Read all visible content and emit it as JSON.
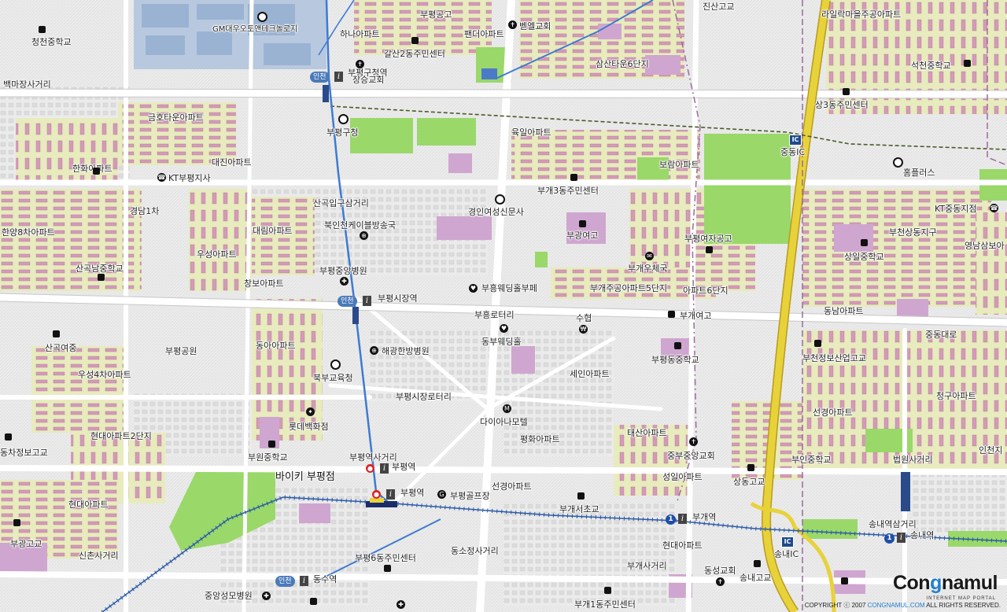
{
  "map": {
    "labels": [
      {
        "id": "gm-daewoo",
        "text": "GM대우오토앤테크놀로지"
      },
      {
        "id": "bupyeong-high",
        "text": "부평공고"
      },
      {
        "id": "jinsan",
        "text": "진산고교"
      },
      {
        "id": "raillak",
        "text": "라일락마을주공아파트"
      },
      {
        "id": "cheongcheon-mid",
        "text": "청천중학교"
      },
      {
        "id": "hana-apt",
        "text": "하나아파트"
      },
      {
        "id": "panda-apt",
        "text": "팬더아파트"
      },
      {
        "id": "bethel",
        "text": "벧엘교회"
      },
      {
        "id": "galsan2",
        "text": "갈산2동주민센터"
      },
      {
        "id": "samsan6",
        "text": "삼산타운6단지"
      },
      {
        "id": "seokcheon-mid",
        "text": "석천중학교"
      },
      {
        "id": "baekma",
        "text": "백마장사거리"
      },
      {
        "id": "bupyeonggu-office-stn",
        "text": "부평구청역"
      },
      {
        "id": "jangseong-church",
        "text": "장승교회"
      },
      {
        "id": "sang3",
        "text": "상3동주민센터"
      },
      {
        "id": "geumho",
        "text": "금호타운아파트"
      },
      {
        "id": "bupyeonggu-office",
        "text": "부평구청"
      },
      {
        "id": "yugil",
        "text": "육일아파트"
      },
      {
        "id": "jungdong-ic",
        "text": "중동IC"
      },
      {
        "id": "homeplus",
        "text": "홈플러스"
      },
      {
        "id": "daejin",
        "text": "대진아파트"
      },
      {
        "id": "boram",
        "text": "보람아파트"
      },
      {
        "id": "hanhwa",
        "text": "한화아파트"
      },
      {
        "id": "kt-bupyeong",
        "text": "KT부평지사"
      },
      {
        "id": "bugae3",
        "text": "부개3동주민센터"
      },
      {
        "id": "sangok-ipgu",
        "text": "산곡입구삼거리"
      },
      {
        "id": "gyeongin-news",
        "text": "경인여성신문사"
      },
      {
        "id": "gyeongnam1",
        "text": "경남1차"
      },
      {
        "id": "kt-jungdong",
        "text": "KT중동지점"
      },
      {
        "id": "hanyang8",
        "text": "한양8차아파트"
      },
      {
        "id": "bukincheon-cable",
        "text": "북인천케이블방송국"
      },
      {
        "id": "daerim",
        "text": "대림아파트"
      },
      {
        "id": "bugwang-girls",
        "text": "부광여고"
      },
      {
        "id": "bucheon-sangdong",
        "text": "부천상동지구"
      },
      {
        "id": "yeongnam-sambo",
        "text": "영남삼보아"
      },
      {
        "id": "woosung",
        "text": "우성아파트"
      },
      {
        "id": "bupyeong-girls-tech",
        "text": "부평여자공고"
      },
      {
        "id": "sangil-mid",
        "text": "상일중학교"
      },
      {
        "id": "sangok-nam-mid",
        "text": "산곡남중학교"
      },
      {
        "id": "bugae-post",
        "text": "부개우체국"
      },
      {
        "id": "bupyeong-jungang-hospital",
        "text": "부평중앙병원"
      },
      {
        "id": "changbo",
        "text": "창보아파트"
      },
      {
        "id": "buheung-wedding",
        "text": "부흥웨딩홀부페"
      },
      {
        "id": "bugae-jugong",
        "text": "부개주공아파트5단지"
      },
      {
        "id": "apt6",
        "text": "아파트6단지"
      },
      {
        "id": "market-stn",
        "text": "부평시장역"
      },
      {
        "id": "buheung-rotary",
        "text": "부흥로터리"
      },
      {
        "id": "suhyup",
        "text": "수협"
      },
      {
        "id": "bugae-girls",
        "text": "부개여고"
      },
      {
        "id": "dongnam",
        "text": "동남아파트"
      },
      {
        "id": "sangok-girls-mid",
        "text": "산곡여중"
      },
      {
        "id": "dongbu-wedding",
        "text": "동부웨딩홀"
      },
      {
        "id": "jungdong-ro",
        "text": "중동대로"
      },
      {
        "id": "bupyeong-park",
        "text": "부평공원"
      },
      {
        "id": "dongah",
        "text": "동아아파트"
      },
      {
        "id": "haekwang",
        "text": "해광한방병원"
      },
      {
        "id": "bupyeong-dong-mid",
        "text": "부평동중학교"
      },
      {
        "id": "bucheon-info",
        "text": "부천정보산업고교"
      },
      {
        "id": "woosung4",
        "text": "우성4차아파트"
      },
      {
        "id": "bukbu-edu",
        "text": "북부교육청"
      },
      {
        "id": "sein",
        "text": "세인아파트"
      },
      {
        "id": "cheonggu",
        "text": "청구아파트"
      },
      {
        "id": "market-rotary",
        "text": "부평시장로터리"
      },
      {
        "id": "lotte",
        "text": "롯데백화점"
      },
      {
        "id": "diana-motel",
        "text": "다이아나모텔"
      },
      {
        "id": "seonkyung-east",
        "text": "선경아파트"
      },
      {
        "id": "hyundai2",
        "text": "현대아파트2단지"
      },
      {
        "id": "taesan",
        "text": "태산아파트"
      },
      {
        "id": "pyeonghwa",
        "text": "평화아파트"
      },
      {
        "id": "auto-tech-high",
        "text": "동차정보고교"
      },
      {
        "id": "jungbu-church",
        "text": "중부중앙교회"
      },
      {
        "id": "bupyeong-sta-junction",
        "text": "부평역사거리"
      },
      {
        "id": "buwon-mid",
        "text": "부원중학교"
      },
      {
        "id": "bupyeong-stn",
        "text": "부평역"
      },
      {
        "id": "bupyeong-stn2",
        "text": "부평역"
      },
      {
        "id": "bikey",
        "text": "바이키 부평점"
      },
      {
        "id": "seongil",
        "text": "성일아파트"
      },
      {
        "id": "buin-mid",
        "text": "부인중학교"
      },
      {
        "id": "court-junction",
        "text": "법원사거리"
      },
      {
        "id": "incheon-right",
        "text": "인천지"
      },
      {
        "id": "golf",
        "text": "부평골프장"
      },
      {
        "id": "seonkyung",
        "text": "선경아파트"
      },
      {
        "id": "sangdong-high",
        "text": "상동고교"
      },
      {
        "id": "hyundai",
        "text": "현대아파트"
      },
      {
        "id": "bugae-west-elem",
        "text": "부개서초교"
      },
      {
        "id": "bugae-stn",
        "text": "부개역"
      },
      {
        "id": "songnae-junction",
        "text": "송내역삼거리"
      },
      {
        "id": "songnae-stn",
        "text": "송내역"
      },
      {
        "id": "bugwang-high",
        "text": "부광고교"
      },
      {
        "id": "sinchon",
        "text": "신촌사거리"
      },
      {
        "id": "dongsojeong",
        "text": "동소정사거리"
      },
      {
        "id": "hyundai-east",
        "text": "현대아파트"
      },
      {
        "id": "songnae-ic",
        "text": "송내IC"
      },
      {
        "id": "bupyeong6",
        "text": "부평6동주민센터"
      },
      {
        "id": "bugae-junction",
        "text": "부개사거리"
      },
      {
        "id": "dongseong-church",
        "text": "동성교회"
      },
      {
        "id": "songnae-high",
        "text": "송내고교"
      },
      {
        "id": "dongsu-stn",
        "text": "동수역"
      },
      {
        "id": "jungang-seongmo",
        "text": "중앙성모병원"
      },
      {
        "id": "bugae1",
        "text": "부개1동주민센터"
      }
    ],
    "badges": {
      "incheon": "인천",
      "ic": "IC",
      "line1": "1",
      "info": "i"
    },
    "logo": {
      "pre": "Con",
      "g": "g",
      "post": "namul",
      "sub": "INTERNET MAP PORTAL"
    },
    "copyright": {
      "pre": "COPYRIGHT ⓒ 2007",
      "site": "CONGNAMUL.COM",
      "post": " ALL RIGHTS RESERVED."
    },
    "colors": {
      "apartment": "#e6ebb4",
      "park": "#9ad86a",
      "highway": "#e8d23a",
      "rail_incheon": "#3e7bd0",
      "rail_line1": "#2a5aa8",
      "boundary": "#9a6aa0"
    }
  }
}
